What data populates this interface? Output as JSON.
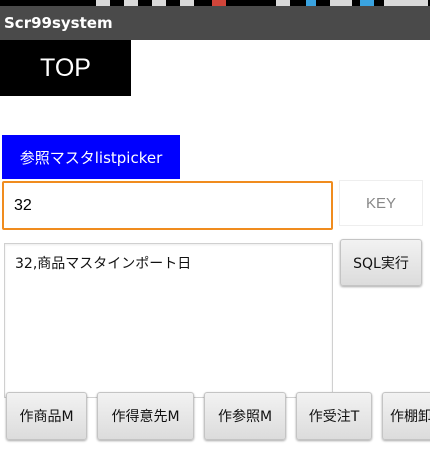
{
  "app": {
    "title": "Scr99system"
  },
  "top_button": {
    "label": "TOP"
  },
  "list_picker": {
    "label": "参照マスタlistpicker",
    "color": "#0000ff"
  },
  "key_input": {
    "value": "32",
    "focus_color": "#f08c1e"
  },
  "key_label": {
    "text": "KEY"
  },
  "result": {
    "text": "32,商品マスタインポート日"
  },
  "sql_button": {
    "label": "SQL実行"
  },
  "bottom_buttons": [
    {
      "label": "作商品M"
    },
    {
      "label": "作得意先M"
    },
    {
      "label": "作参照M"
    },
    {
      "label": "作受注T"
    },
    {
      "label": "作棚卸"
    }
  ]
}
